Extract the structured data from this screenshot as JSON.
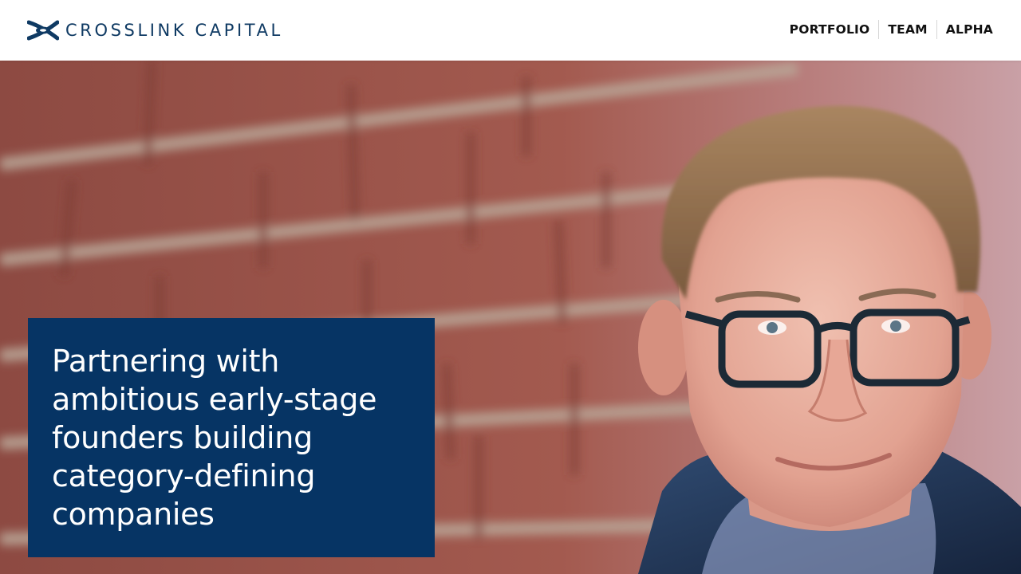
{
  "brand": {
    "name": "CROSSLINK CAPITAL",
    "logo_icon": "crosslink-logo-icon",
    "color": "#0f3a63"
  },
  "nav": {
    "items": [
      {
        "label": "PORTFOLIO"
      },
      {
        "label": "TEAM"
      },
      {
        "label": "ALPHA"
      }
    ]
  },
  "hero": {
    "image": "portrait-photo-man-with-glasses-brick-wall",
    "tagline": "Partnering with ambitious early-stage founders building category-defining companies",
    "box_color": "#063464"
  }
}
